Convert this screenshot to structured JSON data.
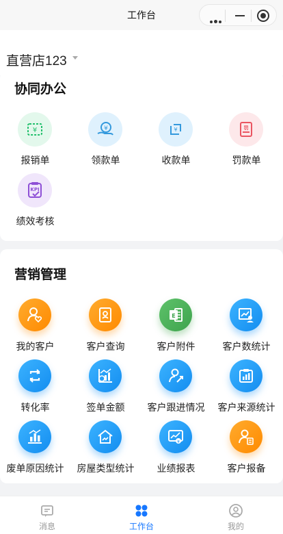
{
  "titlebar": {
    "title": "工作台"
  },
  "store": {
    "name": "直营店123"
  },
  "office": {
    "title": "协同办公",
    "items": [
      {
        "label": "报销单",
        "icon": "reimbursement-icon",
        "color": "#1fbf6a"
      },
      {
        "label": "领款单",
        "icon": "receive-money-icon",
        "color": "#3399dd"
      },
      {
        "label": "收款单",
        "icon": "collection-icon",
        "color": "#3399dd"
      },
      {
        "label": "罚款单",
        "icon": "fine-icon",
        "color": "#ea5561"
      },
      {
        "label": "绩效考核",
        "icon": "kpi-icon",
        "color": "#8e4fd6"
      }
    ]
  },
  "marketing": {
    "title": "营销管理",
    "items": [
      {
        "label": "我的客户",
        "icon": "my-customers-icon",
        "color": "#ff9a1a"
      },
      {
        "label": "客户查询",
        "icon": "customer-search-icon",
        "color": "#ff9a1a"
      },
      {
        "label": "客户附件",
        "icon": "customer-attachment-icon",
        "color": "#4caf50"
      },
      {
        "label": "客户数统计",
        "icon": "customer-count-icon",
        "color": "#1e9ef5"
      },
      {
        "label": "转化率",
        "icon": "conversion-icon",
        "color": "#1e9ef5"
      },
      {
        "label": "签单金额",
        "icon": "contract-amount-icon",
        "color": "#1e9ef5"
      },
      {
        "label": "客户跟进情况",
        "icon": "follow-up-icon",
        "color": "#1e9ef5"
      },
      {
        "label": "客户来源统计",
        "icon": "customer-source-icon",
        "color": "#1e9ef5"
      },
      {
        "label": "废单原因统计",
        "icon": "void-reason-icon",
        "color": "#1e9ef5"
      },
      {
        "label": "房屋类型统计",
        "icon": "house-type-icon",
        "color": "#1e9ef5"
      },
      {
        "label": "业绩报表",
        "icon": "performance-report-icon",
        "color": "#1e9ef5"
      },
      {
        "label": "客户报备",
        "icon": "customer-report-icon",
        "color": "#ff9a1a"
      }
    ]
  },
  "tabbar": {
    "items": [
      {
        "label": "消息",
        "icon": "message-icon"
      },
      {
        "label": "工作台",
        "icon": "workbench-icon",
        "active": true
      },
      {
        "label": "我的",
        "icon": "profile-icon"
      }
    ],
    "active_color": "#1677ff"
  }
}
